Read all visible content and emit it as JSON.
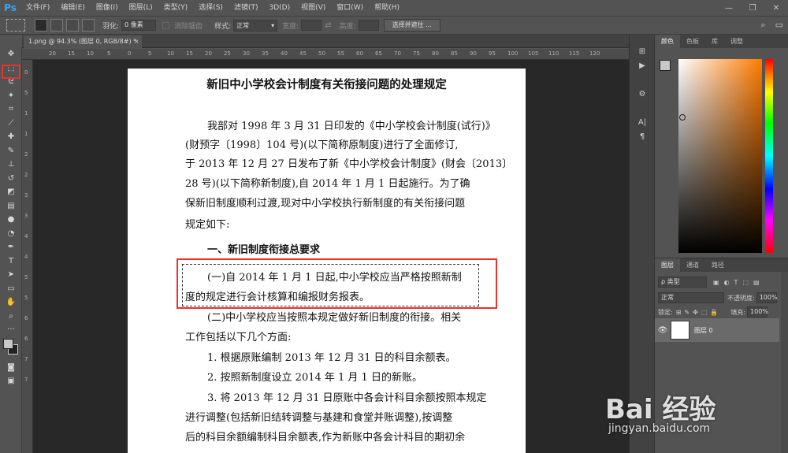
{
  "app": {
    "logo": "Ps"
  },
  "menu": [
    "文件(F)",
    "编辑(E)",
    "图像(I)",
    "图层(L)",
    "类型(Y)",
    "选择(S)",
    "滤镜(T)",
    "3D(D)",
    "视图(V)",
    "窗口(W)",
    "帮助(H)"
  ],
  "window_controls": {
    "minimize": "—",
    "restore": "❐",
    "close": "✕"
  },
  "options": {
    "feather_label": "羽化:",
    "feather_value": "0 像素",
    "antialias_label": "消除锯齿",
    "style_label": "样式:",
    "style_value": "正常",
    "width_label": "宽度:",
    "height_label": "高度:",
    "select_mask_button": "选择并遮住 ..."
  },
  "doc_tab": {
    "title": "1.png @ 94.3% (图层 0, RGB/8#) *",
    "close": "×"
  },
  "ruler_top": [
    "20",
    "15",
    "10",
    "5",
    "0",
    "5",
    "10",
    "15",
    "20",
    "25",
    "30",
    "35",
    "40",
    "45",
    "50",
    "55",
    "60",
    "65",
    "70",
    "75",
    "80",
    "85",
    "90",
    "95",
    "100",
    "105",
    "110",
    "115",
    "120"
  ],
  "ruler_left": [
    "0",
    "5",
    "1",
    "1",
    "2",
    "2",
    "3",
    "3",
    "4",
    "4",
    "5",
    "5",
    "6",
    "6",
    "7",
    "7"
  ],
  "document": {
    "title": "新旧中小学校会计制度有关衔接问题的处理规定",
    "lines": [
      "我部对 1998 年 3 月 31 日印发的《中小学校会计制度(试行)》",
      "(财预字〔1998〕104 号)(以下简称原制度)进行了全面修订,",
      "于 2013 年 12 月 27 日发布了新《中小学校会计制度》(财会〔2013〕",
      "28 号)(以下简称新制度),自 2014 年 1 月 1 日起施行。为了确",
      "保新旧制度顺利过渡,现对中小学校执行新制度的有关衔接问题",
      "规定如下:",
      "一、新旧制度衔接总要求",
      "(一)自 2014 年 1 月 1 日起,中小学校应当严格按照新制",
      "度的规定进行会计核算和编报财务报表。",
      "(二)中小学校应当按照本规定做好新旧制度的衔接。相关",
      "工作包括以下几个方面:",
      "1. 根据原账编制 2013 年 12 月 31 日的科目余额表。",
      "2. 按照新制度设立 2014 年 1 月 1 日的新账。",
      "3. 将 2013 年 12 月 31 日原账中各会计科目余额按照本规定",
      "进行调整(包括新旧结转调整与基建和食堂并账调整),按调整",
      "后的科目余额编制科目余额表,作为新账中各会计科目的期初余"
    ]
  },
  "color_panel": {
    "tabs": [
      "颜色",
      "色板",
      "库",
      "调整"
    ]
  },
  "layers_panel": {
    "tabs": [
      "图层",
      "通道",
      "路径"
    ],
    "filter_label": "ρ 类型",
    "blend_mode": "正常",
    "opacity_label": "不透明度:",
    "opacity_value": "100%",
    "lock_label": "锁定:",
    "fill_label": "填充:",
    "fill_value": "100%",
    "layer_name": "图层 0"
  },
  "watermark": {
    "logo": "Bai 经验",
    "url": "jingyan.baidu.com"
  },
  "colors": {
    "highlight": "#e8332a",
    "ps_blue": "#31a8ff"
  }
}
